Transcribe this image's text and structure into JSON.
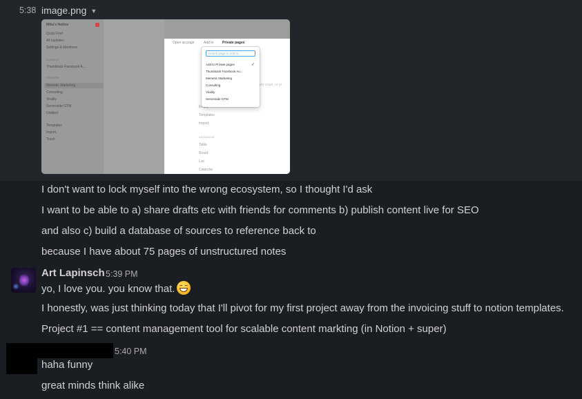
{
  "file_message": {
    "timestamp": "5:38",
    "file_name": "image.png",
    "caret_icon": "caret-down-icon"
  },
  "embedded_screenshot": {
    "sidebar": {
      "workspace": "Mika's Notion",
      "items": [
        "Quick Find",
        "All Updates",
        "Settings & Members"
      ],
      "shared_header": "SHARED",
      "shared_items": [
        "Thumbtack Facebook A..."
      ],
      "private_header": "PRIVATE",
      "private_items": [
        "Memetic Marketing",
        "Consulting",
        "Virality",
        "Serverside GTM",
        "Untitled"
      ],
      "bottom_items": [
        "Templates",
        "Import",
        "Trash"
      ]
    },
    "topbar": {
      "open_as_page": "Open as page",
      "add_to": "Add to",
      "private_pages": "Private pages"
    },
    "dropdown": {
      "search_placeholder": "Search page to add to...",
      "items": [
        "Add to Private pages",
        "Thumbtack Facebook Au...",
        "Memetic Marketing",
        "Consulting",
        "Virality",
        "Serverside GTM"
      ]
    },
    "page_ghost": {
      "empty_hint": "mpty page, or pr",
      "items": [
        "Empty",
        "Templates",
        "Import"
      ],
      "database_header": "DATABASE",
      "database_items": [
        "Table",
        "Board",
        "List",
        "Calendar"
      ]
    }
  },
  "messages_block1": [
    "I don't want to lock myself into the wrong ecosystem, so I thought I'd ask",
    "I want to be able to a) share drafts etc with friends for comments b) publish content live for SEO",
    "and also c) build a database of sources to reference back to",
    "because I have about 75 pages of unstructured notes"
  ],
  "art": {
    "author": "Art Lapinsch",
    "time": "5:39 PM",
    "line1": "yo, I love you. you know that.",
    "emoji_icon": "grinning-face-emoji",
    "line2": "I honestly, was just thinking today that I'll pivot for my first project away from the invoicing stuff to notion templates.",
    "line3": "Project #1 == content management tool for scalable content markting (in Notion + super)"
  },
  "redacted": {
    "time": "5:40 PM",
    "line1": "haha funny",
    "line2": "great minds think alike"
  }
}
